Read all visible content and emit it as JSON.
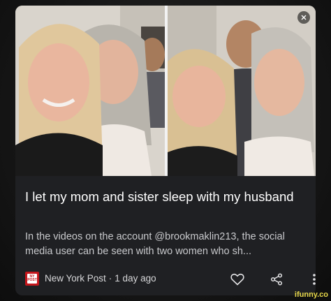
{
  "article": {
    "title": "I let my mom and sister sleep with my husband",
    "snippet": "In the videos on the account @brookmaklin213, the social media user can be seen with two women who sh...",
    "source": "New York Post",
    "time": "1 day ago",
    "separator": "·"
  },
  "icons": {
    "close": "close-icon",
    "publisher_logo": "new-york-post-logo",
    "like": "heart-icon",
    "share": "share-icon",
    "more": "more-vertical-icon"
  },
  "watermark": "ifunny.co",
  "colors": {
    "card_background": "#1f2023",
    "title": "#ffffff",
    "snippet": "#c8c9cc",
    "publisher_logo": "#c4161c",
    "watermark": "#e8d84a"
  }
}
